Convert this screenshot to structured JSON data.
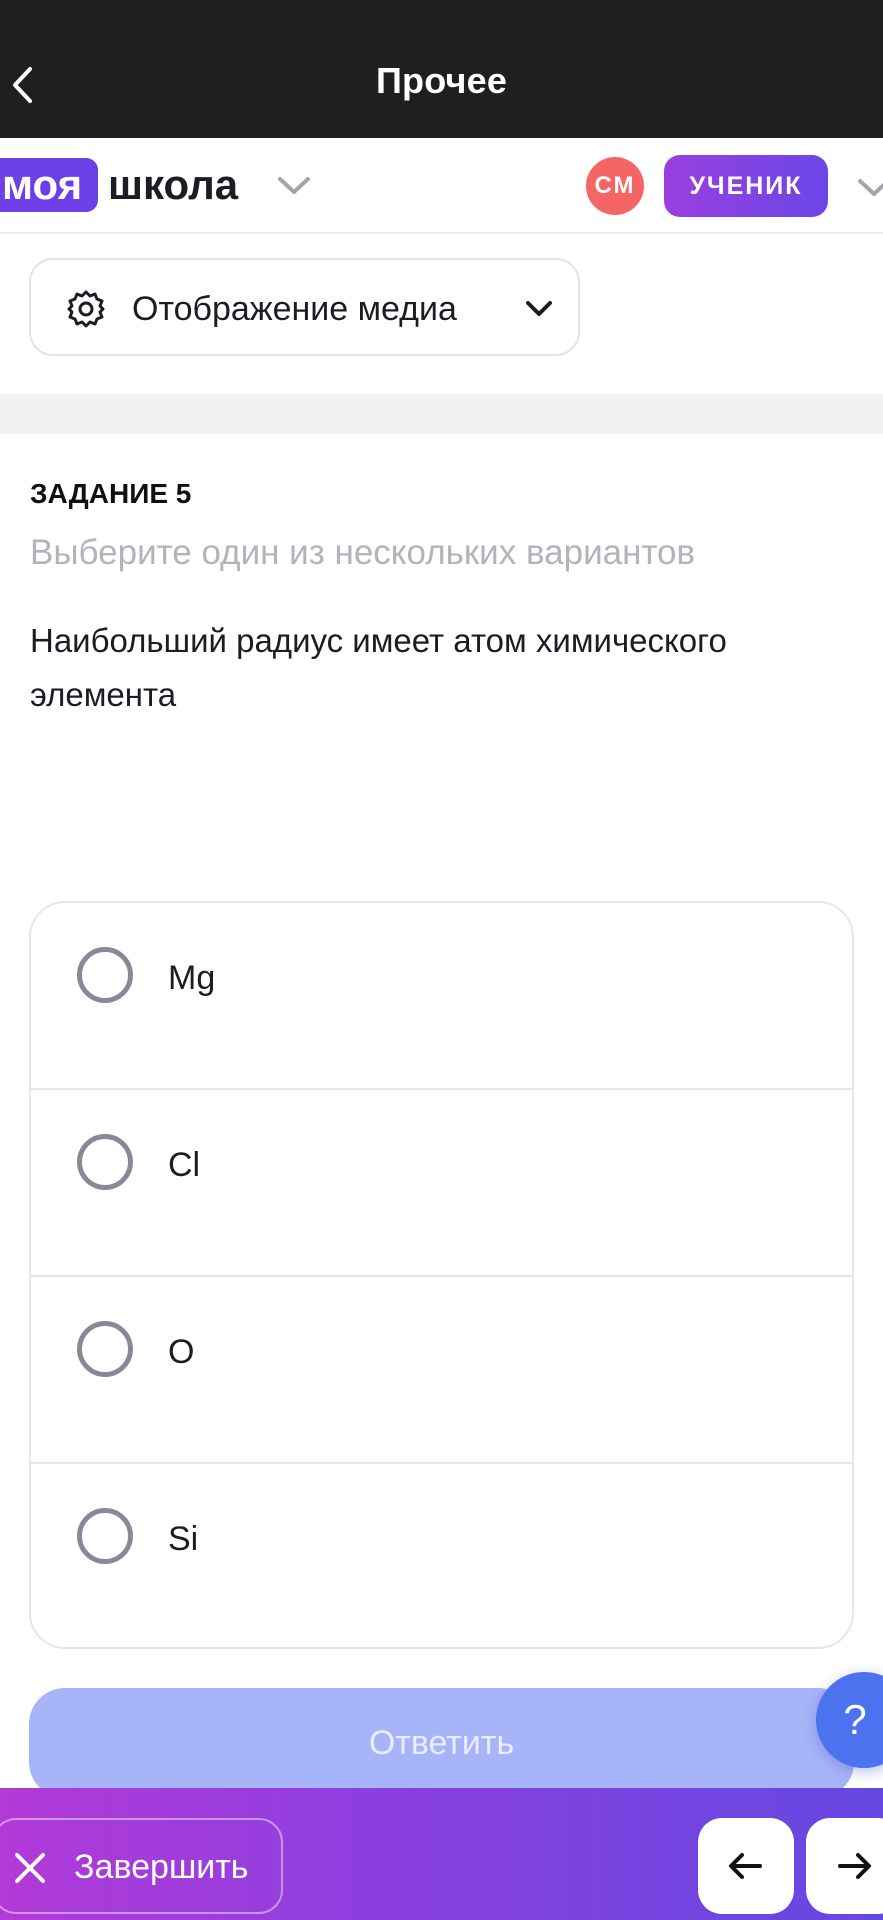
{
  "topbar": {
    "title": "Прочее",
    "back_icon": "chevron-left-icon"
  },
  "brand": {
    "part1": "моя",
    "part2": "школа"
  },
  "user": {
    "initials": "СМ",
    "role": "УЧЕНИК"
  },
  "media": {
    "label": "Отображение медиа"
  },
  "task": {
    "number": "ЗАДАНИЕ 5",
    "hint": "Выберите один из нескольких вариантов",
    "question": "Наибольший радиус имеет атом химического элемента",
    "options": [
      "Mg",
      "Cl",
      "O",
      "Si"
    ]
  },
  "actions": {
    "answer": "Ответить",
    "help": "?",
    "finish": "Завершить"
  },
  "colors": {
    "brand_purple": "#6d3fe6",
    "avatar_red": "#f56565",
    "answer_disabled": "#a8b4f8",
    "help_blue": "#4d72f0"
  }
}
